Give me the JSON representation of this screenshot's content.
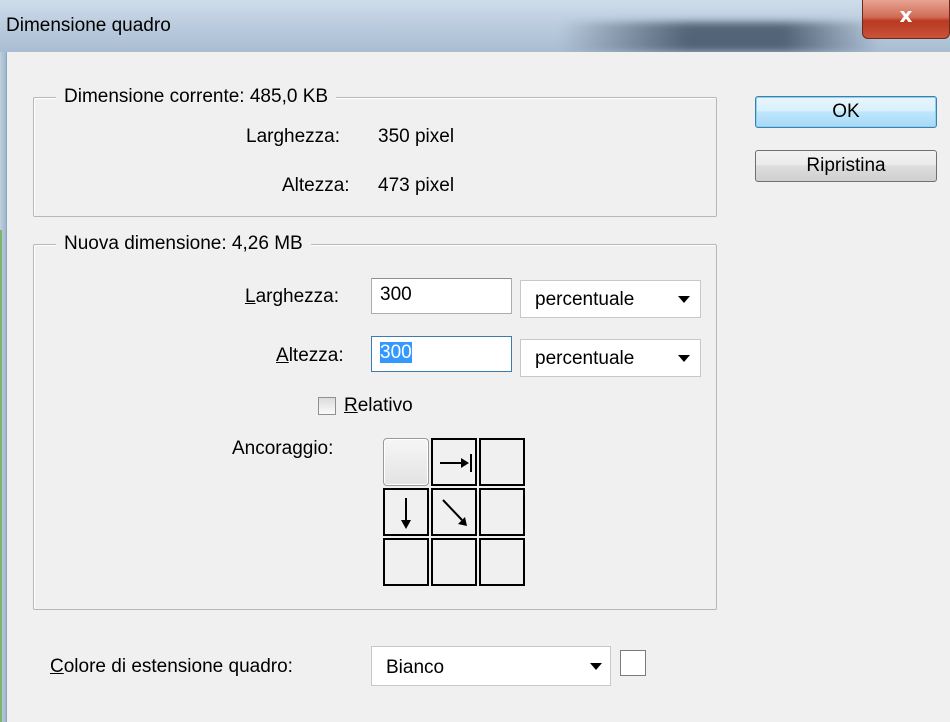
{
  "window": {
    "title": "Dimensione quadro",
    "close_glyph": "x"
  },
  "current": {
    "legend": "Dimensione corrente: 485,0 KB",
    "width_label": "Larghezza:",
    "width_value": "350 pixel",
    "height_label": "Altezza:",
    "height_value": "473 pixel"
  },
  "new_size": {
    "legend": "Nuova dimensione: 4,26 MB",
    "width_label_first": "L",
    "width_label_rest": "arghezza:",
    "width_value": "300",
    "width_unit": "percentuale",
    "height_label_first": "A",
    "height_label_rest": "ltezza:",
    "height_value": "300",
    "height_unit": "percentuale",
    "relative_first": "R",
    "relative_rest": "elativo",
    "relative_checked": false,
    "anchor_label": "Ancoraggio:",
    "anchor_selected": "top-left"
  },
  "extension": {
    "label_first": "C",
    "label_rest": "olore di estensione quadro:",
    "value": "Bianco",
    "swatch_color": "#ffffff"
  },
  "buttons": {
    "ok": "OK",
    "reset": "Ripristina"
  }
}
